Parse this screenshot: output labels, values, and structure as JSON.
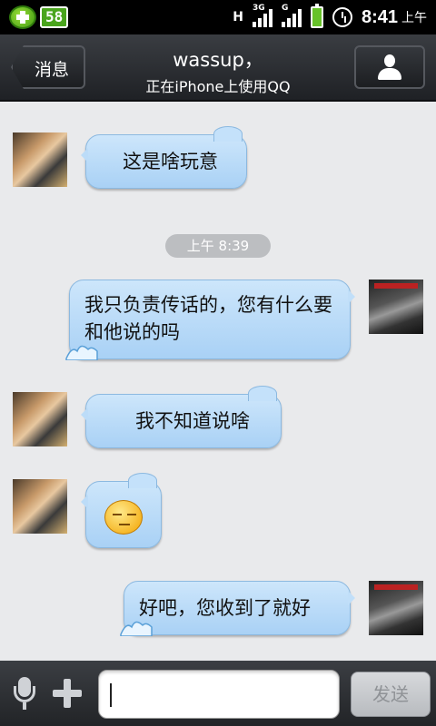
{
  "status_bar": {
    "badge": "58",
    "network_3g": "3G",
    "network_g": "G",
    "hplus": "H",
    "time": "8:41",
    "ampm": "上午"
  },
  "header": {
    "back_label": "消息",
    "contact_name": "wassup，",
    "contact_status": "正在iPhone上使用QQ",
    "profile_icon": "person-icon"
  },
  "chat": {
    "messages": [
      {
        "side": "left",
        "text": "这是啥玩意"
      },
      {
        "side": "right",
        "text": "我只负责传话的，您有什么要和他说的吗"
      },
      {
        "side": "left",
        "text": "我不知道说啥"
      },
      {
        "side": "left",
        "emoji": "speechless-face-emoji"
      },
      {
        "side": "right",
        "text": "好吧，您收到了就好"
      }
    ],
    "timestamp": "上午 8:39"
  },
  "input_bar": {
    "text_value": "",
    "send_label": "发送"
  },
  "colors": {
    "bubble": "#b8dbf8",
    "title_bar": "#2b2d31",
    "chat_background": "#e9eaec"
  }
}
